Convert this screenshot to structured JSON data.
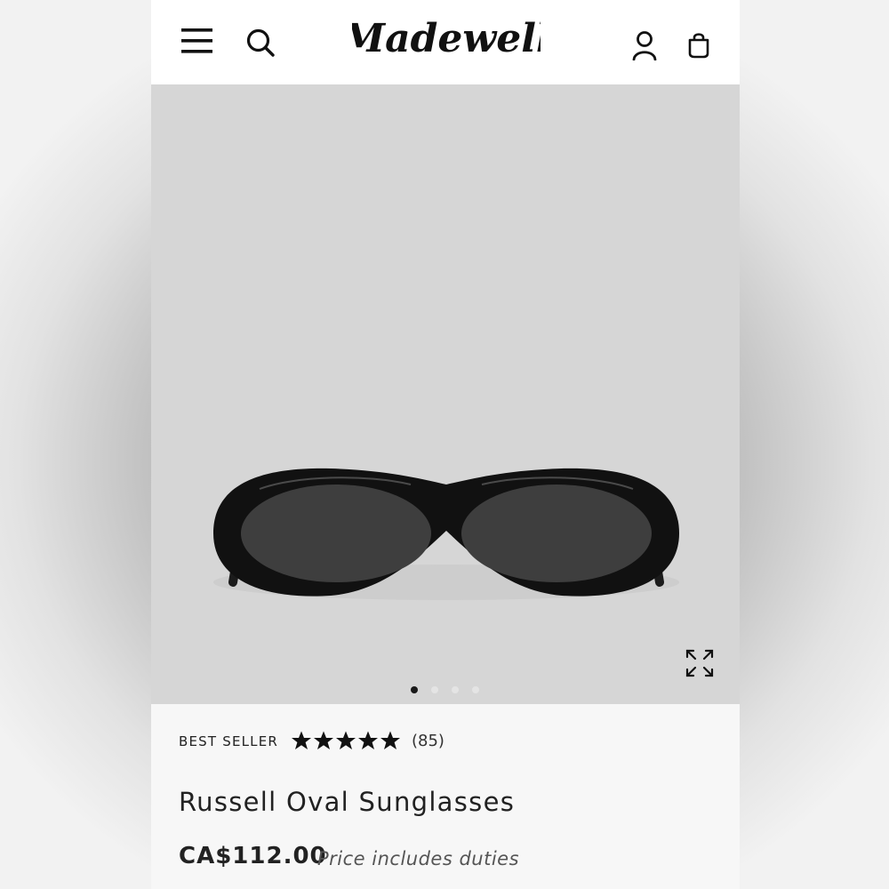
{
  "header": {
    "logo_text": "Madewell",
    "menu_icon": "hamburger-menu-icon",
    "search_icon": "search-icon",
    "account_icon": "user-account-icon",
    "bag_icon": "shopping-bag-icon"
  },
  "gallery": {
    "image": "black oval sunglasses product photo",
    "expand_icon": "expand-arrows-icon",
    "total_slides": 4,
    "active_slide": 1
  },
  "product": {
    "badge": "BEST SELLER",
    "rating": 5,
    "rating_max": 5,
    "review_count": "(85)",
    "title": "Russell Oval Sunglasses",
    "price": "CA$112.00",
    "price_note": "Price includes duties"
  },
  "colors": {
    "hero_background": "#d6d6d6",
    "text": "#222222",
    "dot_active": "#1a1a1a",
    "dot_inactive": "#e4e4e4"
  }
}
